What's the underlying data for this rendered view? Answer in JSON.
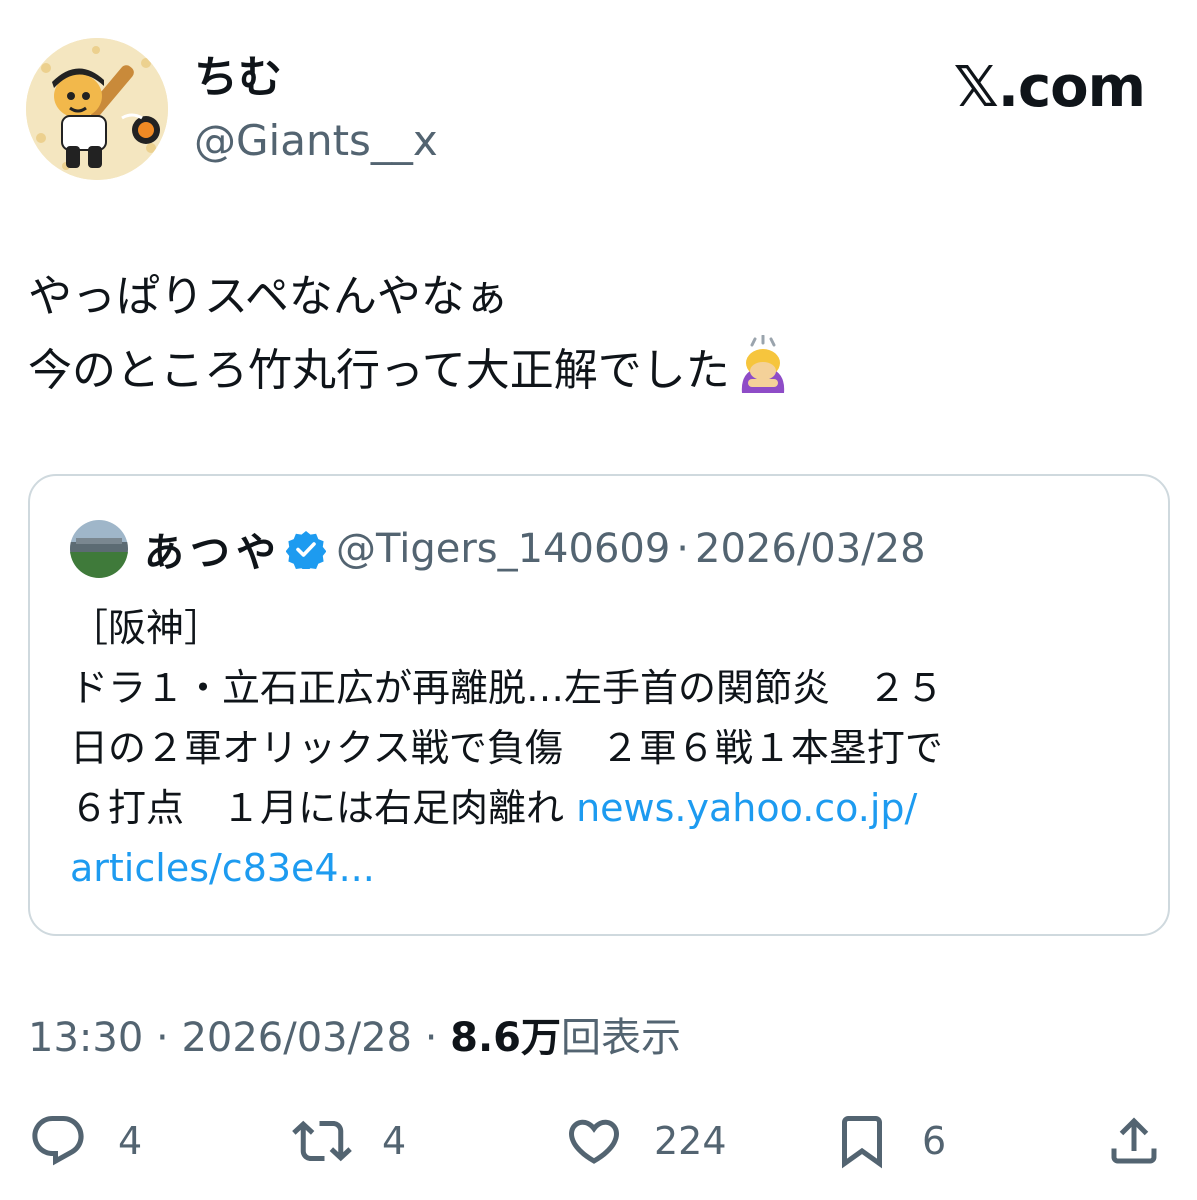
{
  "header": {
    "display_name": "ちむ",
    "handle": "@Giants__x",
    "brand": "𝕏.com"
  },
  "tweet": {
    "lines": [
      "やっぱりスペなんやなぁ",
      "今のところ竹丸行って大正解でした"
    ],
    "emoji": "person-bowing-emoji"
  },
  "quote": {
    "name": "あつや",
    "verified_icon": "verified-badge-icon",
    "handle": "@Tigers_140609",
    "separator": "·",
    "date": "2026/03/28",
    "lines": [
      "［阪神］",
      "ドラ１・立石正広が再離脱…左手首の関節炎　２５",
      "日の２軍オリックス戦で負傷　２軍６戦１本塁打で",
      "６打点　１月には右足肉離れ "
    ],
    "link_part1": "news.yahoo.co.jp/",
    "link_part2": "articles/c83e4..."
  },
  "meta": {
    "time": "13:30",
    "sep": "·",
    "date": "2026/03/28",
    "views_number": "8.6万",
    "views_label": "回表示"
  },
  "actions": {
    "reply": {
      "icon": "reply-icon",
      "count": "4"
    },
    "retweet": {
      "icon": "retweet-icon",
      "count": "4"
    },
    "like": {
      "icon": "heart-icon",
      "count": "224"
    },
    "bookmark": {
      "icon": "bookmark-icon",
      "count": "6"
    },
    "share": {
      "icon": "share-icon"
    }
  },
  "colors": {
    "text": "#0f1419",
    "secondary": "#536471",
    "link": "#1d9bf0",
    "border": "#cfd9de",
    "verified": "#1d9bf0"
  }
}
